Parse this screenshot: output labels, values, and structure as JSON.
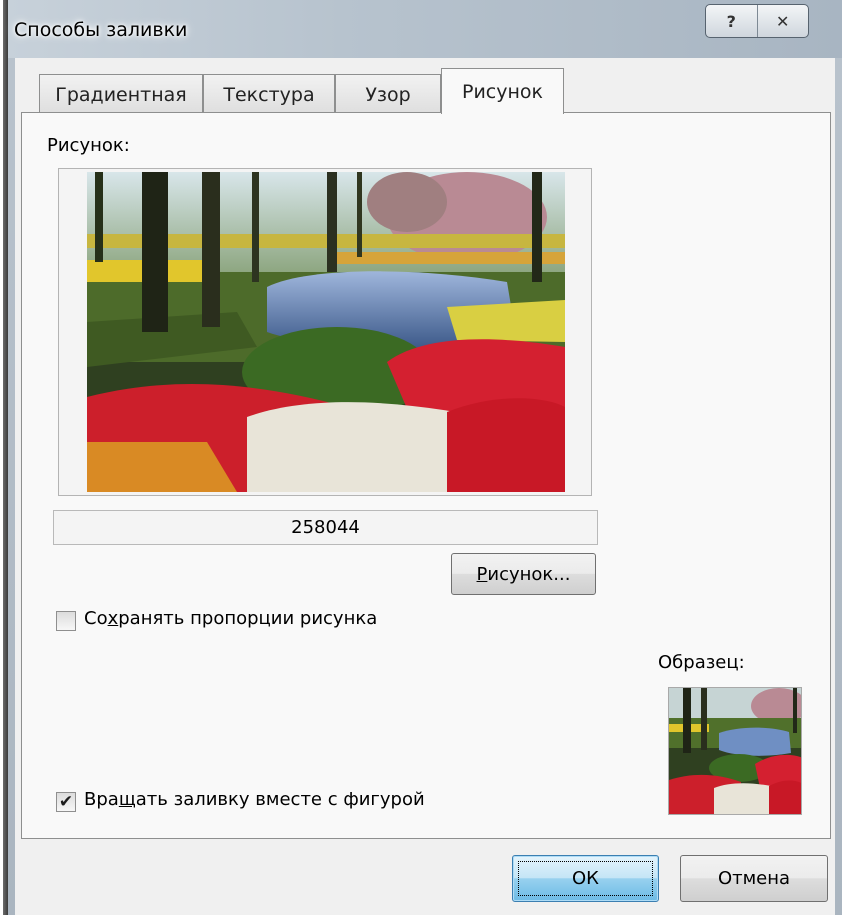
{
  "window": {
    "title": "Способы заливки",
    "help_glyph": "?",
    "close_glyph": "✕"
  },
  "tabs": [
    {
      "label": "Градиентная",
      "active": false
    },
    {
      "label": "Текстура",
      "active": false
    },
    {
      "label": "Узор",
      "active": false
    },
    {
      "label": "Рисунок",
      "active": true
    }
  ],
  "picture_section": {
    "label": "Рисунок:",
    "image_subject": "garden with tulips, pond and trees",
    "file_name": "258044",
    "select_button": {
      "underline_char": "Р",
      "rest": "исунок..."
    }
  },
  "lock_aspect": {
    "label_before": "Со",
    "label_underline": "х",
    "label_after": "ранять пропорции рисунка",
    "checked": false
  },
  "rotate_with_shape": {
    "label_before": "Вра",
    "label_underline": "щ",
    "label_after": "ать заливку вместе с фигурой",
    "checked": true,
    "check_glyph": "✔"
  },
  "sample": {
    "label": "Образец:"
  },
  "footer": {
    "ok_label": "ОК",
    "cancel_label": "Отмена"
  },
  "colors": {
    "titlebar": "#b7c3ce",
    "dialog_bg": "#f0f0f0",
    "panel_bg": "#f9f9f9",
    "default_button": "#98d1ef"
  }
}
